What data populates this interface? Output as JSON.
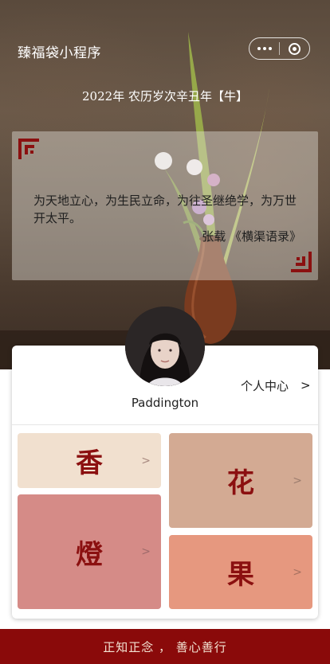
{
  "app": {
    "title": "臻福袋小程序"
  },
  "capsule": {
    "more_icon": "more-dots-icon",
    "close_icon": "mini-program-close-icon"
  },
  "header": {
    "date_line": "2022年 农历岁次辛丑年【牛】"
  },
  "quote": {
    "text": "为天地立心，为生民立命，为往圣继绝学，为万世开太平。",
    "author": "张载 《横渠语录》"
  },
  "profile": {
    "username": "Paddington",
    "center_label": "个人中心",
    "center_arrow": ">"
  },
  "tiles": [
    {
      "glyph": "香",
      "arrow": ">",
      "color": "#f1e0cf"
    },
    {
      "glyph": "花",
      "arrow": ">",
      "color": "#d3aa93"
    },
    {
      "glyph": "燈",
      "arrow": ">",
      "color": "#d58b87"
    },
    {
      "glyph": "果",
      "arrow": ">",
      "color": "#e6987f"
    }
  ],
  "footer": {
    "motto": "正知正念 ， 善心善行"
  },
  "colors": {
    "accent": "#8a0a0a",
    "glyph": "#8b1010"
  }
}
